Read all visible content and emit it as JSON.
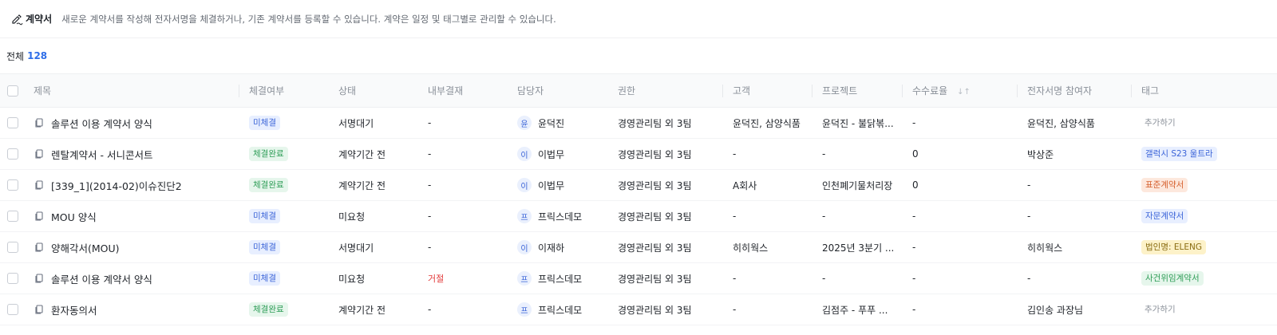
{
  "header": {
    "title": "계약서",
    "description": "새로운 계약서를 작성해 전자서명을 체결하거나, 기존 계약서를 등록할 수 있습니다. 계약은 일정 및 태그별로 관리할 수 있습니다."
  },
  "summary": {
    "label": "전체",
    "count": "128"
  },
  "columns": {
    "title": "제목",
    "signed": "체결여부",
    "status": "상태",
    "approval": "내부결재",
    "manager": "담당자",
    "permission": "권한",
    "customer": "고객",
    "project": "프로젝트",
    "fee": "수수료율",
    "participants": "전자서명 참여자",
    "tags": "태그"
  },
  "rows": [
    {
      "title": "솔루션 이용 계약서 양식",
      "signed": "미체결",
      "status": "서명대기",
      "approval": "-",
      "manager_initial": "윤",
      "manager": "윤덕진",
      "permission": "경영관리팀 외 3팀",
      "customer": "윤덕진, 삼양식품",
      "project": "윤덕진 - 불닭볶...",
      "fee": "-",
      "participants": "윤덕진, 삼양식품",
      "tag": "추가하기"
    },
    {
      "title": "렌탈계약서 - 서니콘서트",
      "signed": "체결완료",
      "status": "계약기간 전",
      "approval": "-",
      "manager_initial": "이",
      "manager": "이법무",
      "permission": "경영관리팀 외 3팀",
      "customer": "-",
      "project": "-",
      "fee": "0",
      "participants": "박상준",
      "tag": "갤럭시 S23 울트라"
    },
    {
      "title": "[339_1](2014-02)이슈진단2",
      "signed": "체결완료",
      "status": "계약기간 전",
      "approval": "-",
      "manager_initial": "이",
      "manager": "이법무",
      "permission": "경영관리팀 외 3팀",
      "customer": "A회사",
      "project": "인천폐기물처리장",
      "fee": "0",
      "participants": "-",
      "tag": "표준계약서"
    },
    {
      "title": "MOU 양식",
      "signed": "미체결",
      "status": "미요청",
      "approval": "-",
      "manager_initial": "프",
      "manager": "프릭스데모",
      "permission": "경영관리팀 외 3팀",
      "customer": "-",
      "project": "-",
      "fee": "-",
      "participants": "-",
      "tag": "자문계약서"
    },
    {
      "title": "양해각서(MOU)",
      "signed": "미체결",
      "status": "서명대기",
      "approval": "-",
      "manager_initial": "이",
      "manager": "이재하",
      "permission": "경영관리팀 외 3팀",
      "customer": "히히웍스",
      "project": "2025년 3분기 ...",
      "fee": "-",
      "participants": "히히웍스",
      "tag": "법인명: ELENG"
    },
    {
      "title": "솔루션 이용 계약서 양식",
      "signed": "미체결",
      "status": "미요청",
      "approval": "거절",
      "manager_initial": "프",
      "manager": "프릭스데모",
      "permission": "경영관리팀 외 3팀",
      "customer": "-",
      "project": "-",
      "fee": "-",
      "participants": "-",
      "tag": "사건위임계약서"
    },
    {
      "title": "환자동의서",
      "signed": "체결완료",
      "status": "계약기간 전",
      "approval": "-",
      "manager_initial": "프",
      "manager": "프릭스데모",
      "permission": "경영관리팀 외 3팀",
      "customer": "-",
      "project": "김점주 - 푸푸 ...",
      "fee": "-",
      "participants": "김인송 과장님",
      "tag": "추가하기"
    }
  ],
  "colors": {
    "accent": "#2f6ee8",
    "badge_unsigned": "#3b64d8",
    "badge_signed": "#2e9d57",
    "reject": "#e23a3a"
  }
}
